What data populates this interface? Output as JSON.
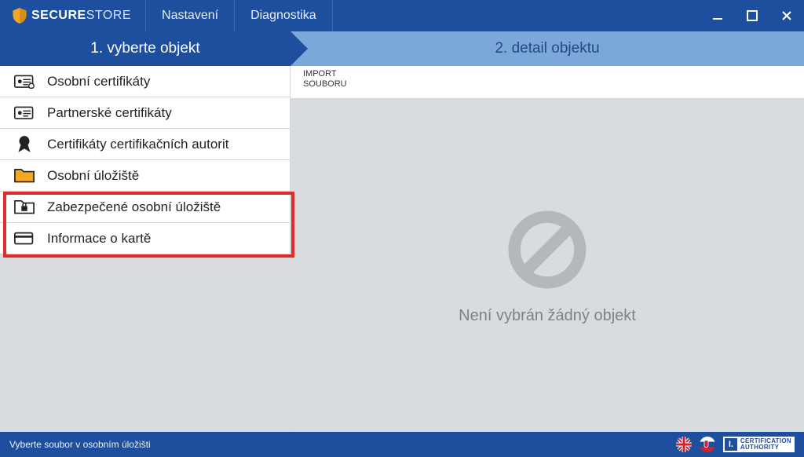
{
  "app": {
    "brand_a": "SECURE",
    "brand_b": "STORE"
  },
  "menu": {
    "settings": "Nastavení",
    "diagnostics": "Diagnostika"
  },
  "steps": {
    "one": "1. vyberte objekt",
    "two": "2. detail objektu"
  },
  "sidebar": {
    "items": [
      {
        "label": "Osobní certifikáty"
      },
      {
        "label": "Partnerské certifikáty"
      },
      {
        "label": "Certifikáty certifikačních autorit"
      },
      {
        "label": "Osobní úložiště"
      },
      {
        "label": "Zabezpečené osobní úložiště"
      },
      {
        "label": "Informace o kartě"
      }
    ]
  },
  "detail": {
    "toolbar": {
      "import": "IMPORT\nSOUBORU"
    },
    "empty_text": "Není vybrán žádný objekt"
  },
  "status": {
    "hint": "Vyberte soubor v osobním úložišti"
  },
  "footer": {
    "cert_line1": "CERTIFICATION",
    "cert_line2": "AUTHORITY"
  }
}
